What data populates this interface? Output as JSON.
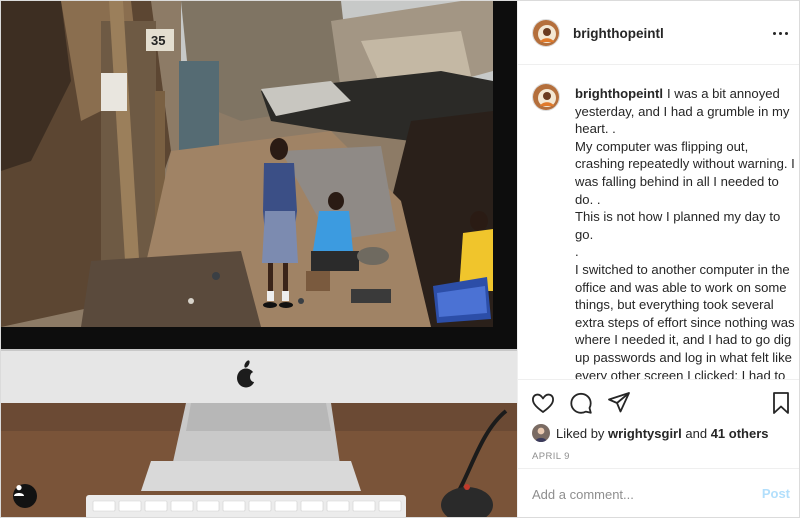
{
  "post": {
    "username": "brighthopeintl",
    "more_icon": "more-horizontal-icon"
  },
  "caption": {
    "username": "brighthopeintl",
    "lines": [
      "I was a bit annoyed yesterday, and I had a grumble in my heart. .",
      "My computer was flipping out, crashing repeatedly without warning. I was falling behind in all I needed to do. .",
      "This is not how I planned my day to go.",
      ".",
      "I switched to another computer in the office and was able to work on some things, but everything took several extra steps of effort since nothing was where I needed it, and I had to go dig up passwords and log in what felt like every other screen I clicked; I had to email myself things and bounce between computers because this one didn't have software the other one did.",
      "."
    ]
  },
  "photo": {
    "house_number": "35",
    "user_tag_icon": "user-icon"
  },
  "actions": {
    "like_icon": "heart-icon",
    "comment_icon": "comment-icon",
    "share_icon": "paper-plane-icon",
    "save_icon": "bookmark-icon"
  },
  "likes": {
    "prefix": "Liked by",
    "user": "wrightysgirl",
    "and": "and",
    "others": "41 others"
  },
  "date": "APRIL 9",
  "comment": {
    "placeholder": "Add a comment...",
    "post_label": "Post"
  },
  "colors": {
    "post_button_disabled": "#b2dffc",
    "muted_text": "#8e8e8e",
    "border": "#efefef"
  }
}
